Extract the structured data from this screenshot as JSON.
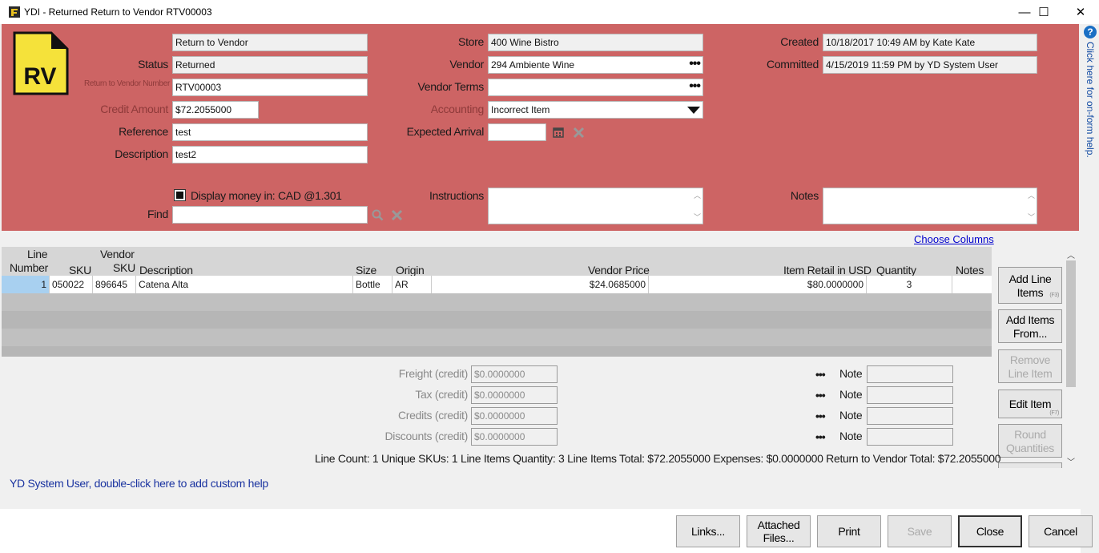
{
  "window": {
    "title": "YDI - Returned Return to Vendor RTV00003",
    "minimize": "—",
    "maximize": "☐",
    "close": "✕"
  },
  "logo": {
    "text": "RV"
  },
  "header": {
    "doc_type": "Return to Vendor",
    "status_label": "Status",
    "status": "Returned",
    "rtv_number_label": "Return to Vendor Number",
    "rtv_number": "RTV00003",
    "credit_amount_label": "Credit Amount",
    "credit_amount": "$72.2055000",
    "reference_label": "Reference",
    "reference": "test",
    "description_label": "Description",
    "description": "test2",
    "display_money_label": "Display money in: CAD  @1.301",
    "find_label": "Find",
    "find_value": "",
    "store_label": "Store",
    "store": "400 Wine Bistro",
    "vendor_label": "Vendor",
    "vendor": "294 Ambiente Wine",
    "vendor_terms_label": "Vendor Terms",
    "vendor_terms": "",
    "accounting_label": "Accounting",
    "accounting": "Incorrect Item",
    "expected_arrival_label": "Expected Arrival",
    "expected_arrival": "",
    "instructions_label": "Instructions",
    "instructions": "",
    "created_label": "Created",
    "created": "10/18/2017 10:49 AM by Kate Kate",
    "committed_label": "Committed",
    "committed": "4/15/2019 11:59 PM by YD System User",
    "notes_label": "Notes",
    "notes": ""
  },
  "help_side": {
    "icon": "?",
    "text": "Click here for on-form help."
  },
  "choose_columns": "Choose Columns",
  "grid": {
    "columns": {
      "line_number_1": "Line",
      "line_number_2": "Number",
      "sku": "SKU",
      "vendor_sku_1": "Vendor",
      "vendor_sku_2": "SKU",
      "description": "Description",
      "size": "Size",
      "origin": "Origin",
      "vendor_price": "Vendor Price",
      "item_retail": "Item Retail in USD",
      "quantity": "Quantity",
      "notes": "Notes"
    },
    "rows": [
      {
        "line": "1",
        "sku": "050022",
        "vendor_sku": "896645",
        "description": "Catena Alta",
        "size": "Bottle",
        "origin": "AR",
        "vendor_price": "$24.0685000",
        "item_retail": "$80.0000000",
        "quantity": "3",
        "notes": ""
      }
    ]
  },
  "side_buttons": {
    "add_line_items": "Add Line Items",
    "add_line_items_key": "(F3)",
    "add_items_from": "Add Items From...",
    "remove_line_item": "Remove Line Item",
    "edit_item": "Edit Item",
    "edit_item_key": "(F7)",
    "round_quantities": "Round Quantities"
  },
  "expenses": {
    "freight_label": "Freight (credit)",
    "freight": "$0.0000000",
    "tax_label": "Tax (credit)",
    "tax": "$0.0000000",
    "credits_label": "Credits (credit)",
    "credits": "$0.0000000",
    "discounts_label": "Discounts (credit)",
    "discounts": "$0.0000000",
    "note_label": "Note",
    "dots": "•••"
  },
  "summary": "Line Count: 1 Unique SKUs: 1   Line Items Quantity: 3   Line Items Total: $72.2055000   Expenses: $0.0000000   Return to Vendor Total: $72.2055000",
  "custom_help": "YD System User, double-click here to add custom help",
  "footer": {
    "links": "Links...",
    "attached_files": "Attached Files...",
    "print": "Print",
    "save": "Save",
    "close": "Close",
    "cancel": "Cancel"
  },
  "colors": {
    "header_bg": "#cd6464",
    "selected_cell": "#a8d0f0",
    "link": "#0000cc"
  }
}
